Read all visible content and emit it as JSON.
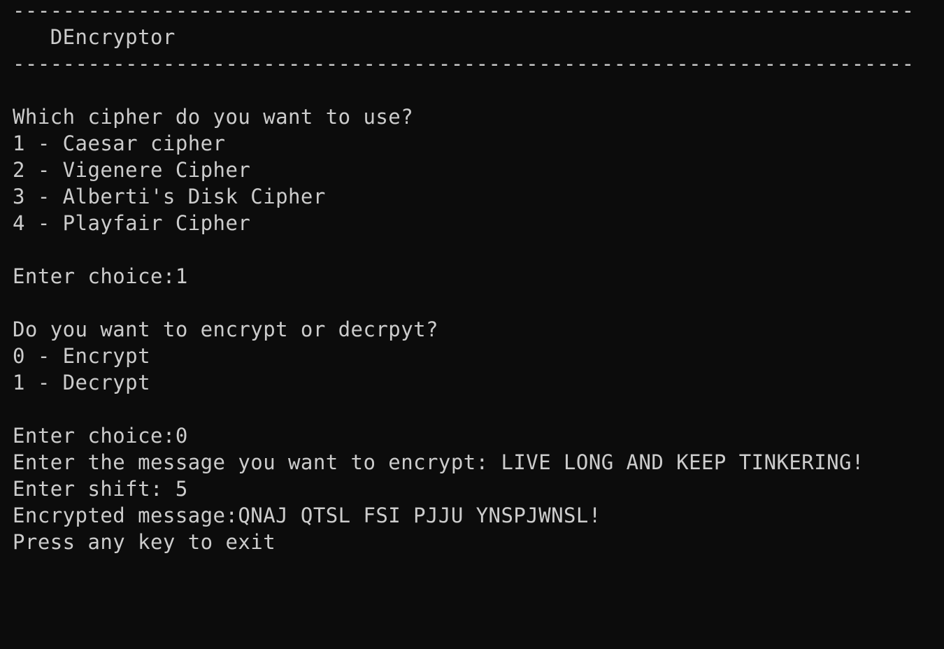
{
  "console": {
    "separator": "------------------------------------------------------------------------",
    "title": "   DEncryptor",
    "cipher_prompt": "Which cipher do you want to use?",
    "cipher_options": [
      "1 - Caesar cipher",
      "2 - Vigenere Cipher",
      "3 - Alberti's Disk Cipher",
      "4 - Playfair Cipher"
    ],
    "cipher_choice_line": "Enter choice:1",
    "mode_prompt": "Do you want to encrypt or decrpyt?",
    "mode_options": [
      "0 - Encrypt",
      "1 - Decrypt"
    ],
    "mode_choice_line": "Enter choice:0",
    "message_line": "Enter the message you want to encrypt: LIVE LONG AND KEEP TINKERING!",
    "shift_line": "Enter shift: 5",
    "result_line": "Encrypted message:QNAJ QTSL FSI PJJU YNSPJWNSL!",
    "exit_line": "Press any key to exit"
  },
  "colors": {
    "background": "#0c0c0c",
    "foreground": "#cccccc"
  }
}
